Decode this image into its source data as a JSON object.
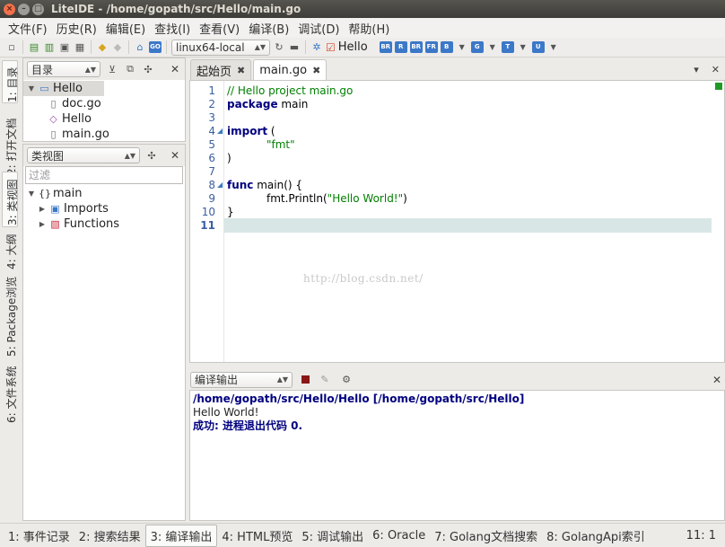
{
  "window": {
    "title": "LiteIDE - /home/gopath/src/Hello/main.go"
  },
  "menu": [
    "文件(F)",
    "历史(R)",
    "编辑(E)",
    "查找(I)",
    "查看(V)",
    "编译(B)",
    "调试(D)",
    "帮助(H)"
  ],
  "toolbar": {
    "env_combo": "linux64-local",
    "build_target": "Hello",
    "icon_labels": [
      "BR",
      "R",
      "BR",
      "FR",
      "B",
      "G",
      "T",
      "U"
    ]
  },
  "left_tabs": [
    "1: 目录",
    "2: 打开文档",
    "3: 类视图",
    "4: 大纲",
    "5: Package浏览",
    "6: 文件系统"
  ],
  "folder_panel": {
    "combo": "目录",
    "tree": [
      {
        "label": "Hello",
        "level": 0,
        "type": "folder"
      },
      {
        "label": "doc.go",
        "level": 1,
        "type": "file"
      },
      {
        "label": "Hello",
        "level": 1,
        "type": "binary"
      },
      {
        "label": "main.go",
        "level": 1,
        "type": "file"
      }
    ]
  },
  "class_panel": {
    "combo": "类视图",
    "filter_placeholder": "过滤",
    "tree": [
      {
        "label": "main",
        "level": 0
      },
      {
        "label": "Imports",
        "level": 1
      },
      {
        "label": "Functions",
        "level": 1
      }
    ]
  },
  "editor": {
    "tabs": [
      {
        "label": "起始页",
        "active": false
      },
      {
        "label": "main.go",
        "active": true
      }
    ],
    "line_numbers": [
      "1",
      "2",
      "3",
      "4",
      "5",
      "6",
      "7",
      "8",
      "9",
      "10",
      "11"
    ],
    "code": {
      "l1": "// Hello project main.go",
      "l2_kw": "package",
      "l2_rest": " main",
      "l4_kw": "import",
      "l4_rest": " (",
      "l5": "\"fmt\"",
      "l6": ")",
      "l8_kw": "func",
      "l8_rest": " main() {",
      "l9_pre": "fmt.Println(",
      "l9_str": "\"Hello World!\"",
      "l9_post": ")",
      "l10": "}"
    },
    "watermark": "http://blog.csdn.net/"
  },
  "output": {
    "combo": "编译输出",
    "lines": [
      "/home/gopath/src/Hello/Hello  [/home/gopath/src/Hello]",
      "Hello World!",
      "成功: 进程退出代码 0."
    ]
  },
  "statusbar": {
    "tabs": [
      "1: 事件记录",
      "2: 搜索结果",
      "3: 编译输出",
      "4: HTML预览",
      "5: 调试输出",
      "6: Oracle",
      "7: Golang文档搜索",
      "8: GolangApi索引"
    ],
    "position": "11:  1"
  }
}
